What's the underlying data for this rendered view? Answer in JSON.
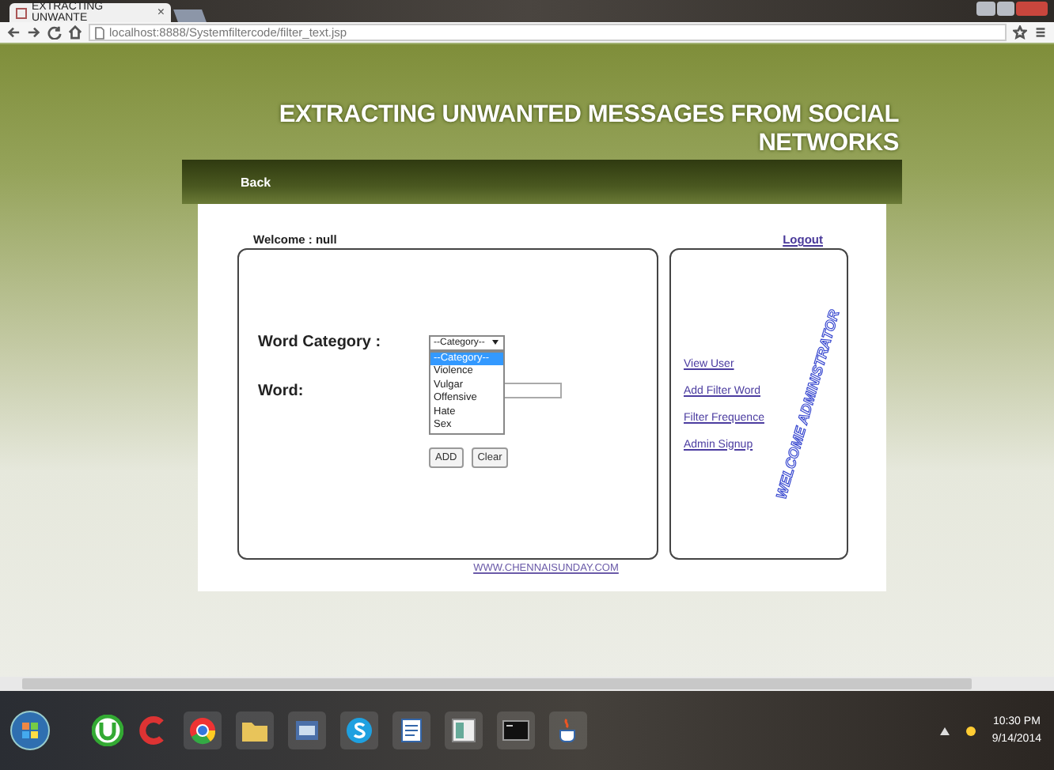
{
  "browser": {
    "tab": {
      "title": "EXTRACTING UNWANTE",
      "close": "×"
    },
    "address": "localhost:8888/Systemfiltercode/filter_text.jsp"
  },
  "page": {
    "title": "EXTRACTING UNWANTED MESSAGES FROM SOCIAL NETWORKS",
    "back": "Back",
    "welcome": "Welcome : null",
    "logout": "Logout",
    "form": {
      "category_label": "Word Category :",
      "category_select": {
        "value": "--Category--",
        "expanded": true,
        "options": [
          {
            "label": "--Category--",
            "selected": true
          },
          {
            "label": "Violence",
            "selected": false
          },
          {
            "label": "Vulgar",
            "selected": false
          },
          {
            "label": "Offensive",
            "selected": false
          },
          {
            "label": "Hate",
            "selected": false
          },
          {
            "label": "Sex",
            "selected": false
          }
        ]
      },
      "word_label": "Word:",
      "buttons": [
        "ADD",
        "Clear"
      ]
    },
    "admin_menu": {
      "watermark": "WELCOME ADMINISTRATOR",
      "links": [
        "View User",
        "Add Filter Word",
        "Filter Frequence",
        "Admin Signup"
      ]
    },
    "footer_link": "WWW.CHENNAISUNDAY.COM"
  },
  "taskbar": {
    "time": "10:30 PM",
    "date": "9/14/2014"
  }
}
